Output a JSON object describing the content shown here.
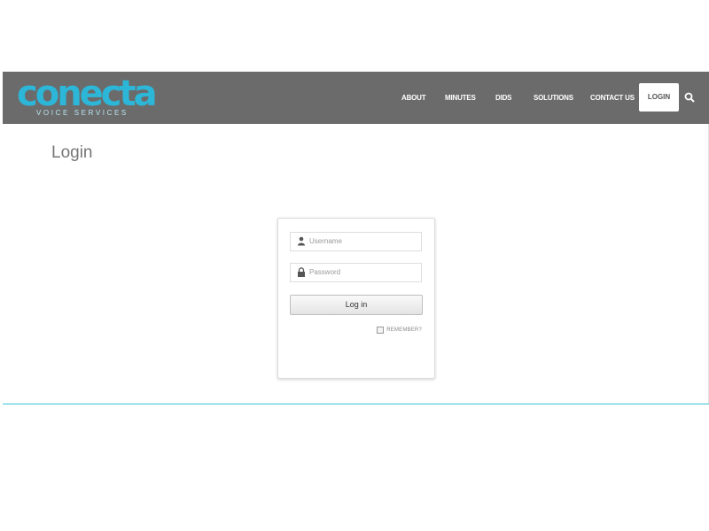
{
  "brand": {
    "name": "conecta",
    "tagline": "VOICE SERVICES",
    "color": "#2cb6d8"
  },
  "nav": {
    "items": [
      {
        "label": "ABOUT"
      },
      {
        "label": "MINUTES"
      },
      {
        "label": "DIDS"
      },
      {
        "label": "SOLUTIONS"
      },
      {
        "label": "CONTACT US"
      }
    ],
    "login": "LOGIN",
    "search_icon": "search-icon"
  },
  "page": {
    "title": "Login"
  },
  "form": {
    "username_placeholder": "Username",
    "password_placeholder": "Password",
    "submit_label": "Log in",
    "remember_label": "REMEMBER?"
  },
  "colors": {
    "header_bg": "#6b6b6b",
    "accent_line": "#3cc4d8"
  }
}
